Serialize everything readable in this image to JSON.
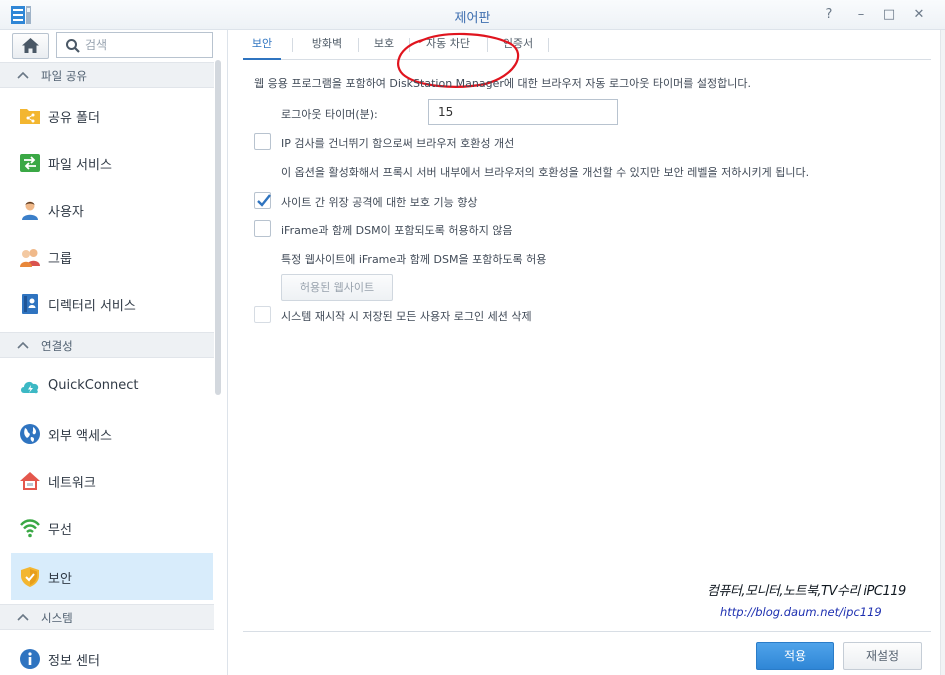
{
  "window": {
    "title": "제어판",
    "help_symbol": "?",
    "minimize_symbol": "–",
    "maximize_symbol": "□",
    "close_symbol": "✕"
  },
  "sidebar": {
    "search_placeholder": "검색",
    "sections": [
      {
        "label": "파일 공유"
      },
      {
        "label": "연결성"
      },
      {
        "label": "시스템"
      }
    ],
    "items": [
      {
        "label": "공유 폴더",
        "icon": "shared-folder-icon"
      },
      {
        "label": "파일 서비스",
        "icon": "file-services-icon"
      },
      {
        "label": "사용자",
        "icon": "user-icon"
      },
      {
        "label": "그룹",
        "icon": "group-icon"
      },
      {
        "label": "디렉터리 서비스",
        "icon": "directory-service-icon"
      },
      {
        "label": "QuickConnect",
        "icon": "quickconnect-icon"
      },
      {
        "label": "외부 액세스",
        "icon": "external-access-icon"
      },
      {
        "label": "네트워크",
        "icon": "network-icon"
      },
      {
        "label": "무선",
        "icon": "wireless-icon"
      },
      {
        "label": "보안",
        "icon": "security-icon",
        "active": true
      },
      {
        "label": "정보 센터",
        "icon": "info-center-icon"
      }
    ]
  },
  "tabs": [
    {
      "label": "보안",
      "active": true
    },
    {
      "label": "방화벽"
    },
    {
      "label": "보호"
    },
    {
      "label": "자동 차단"
    },
    {
      "label": "인증서"
    }
  ],
  "content": {
    "description": "웹 응용 프로그램을 포함하여 DiskStation Manager에 대한 브라우저 자동 로그아웃 타이머를 설정합니다.",
    "logout_timer_label": "로그아웃 타이머(분):",
    "logout_timer_value": "15",
    "options": [
      {
        "label": "IP 검사를 건너뛰기 함으로써 브라우저 호환성 개선",
        "checked": false
      },
      {
        "label": "사이트 간 위장 공격에 대한 보호 기능 향상",
        "checked": true
      },
      {
        "label": "iFrame과 함께 DSM이 포함되도록 허용하지 않음",
        "checked": false
      },
      {
        "label": "시스템 재시작 시 저장된 모든 사용자 로그인 세션 삭제",
        "checked": false
      }
    ],
    "ip_check_note": "이 옵션을 활성화해서 프록시 서버 내부에서 브라우저의 호환성을 개선할 수 있지만 보안 레벨을 저하시키게 됩니다.",
    "iframe_note": "특정 웹사이트에 iFrame과 함께 DSM을 포함하도록 허용",
    "allowed_sites_button": "허용된 웹사이트"
  },
  "watermark": {
    "line1": "컴퓨터,모니터,노트북,TV수리 iPC119",
    "line2": "http://blog.daum.net/ipc119"
  },
  "footer": {
    "apply_label": "적용",
    "reset_label": "재설정"
  },
  "colors": {
    "accent": "#2f74c0",
    "active_item_bg": "#d8ecfb",
    "annotation_circle": "#e0141e",
    "watermark_link": "#1d2fb0"
  }
}
